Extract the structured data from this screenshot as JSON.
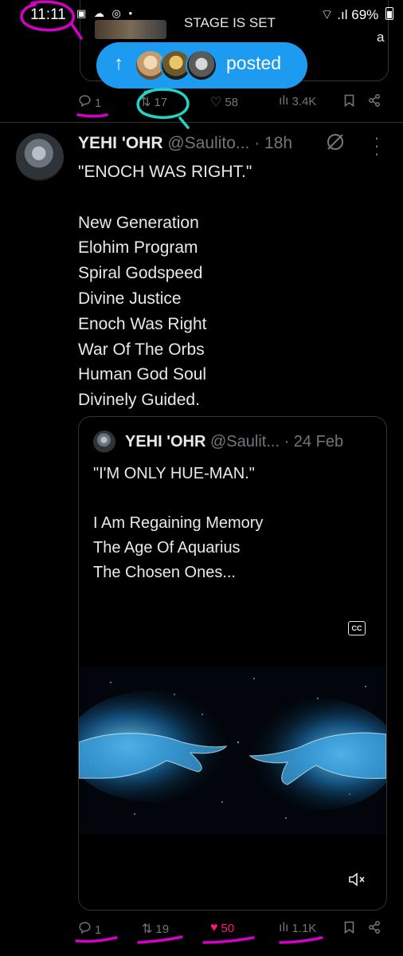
{
  "status_bar": {
    "time": "11:11",
    "left_icons": "▣ ☁ ◎ •",
    "right_icons": "⌔ .ıl",
    "battery": "69%"
  },
  "prev_tweet": {
    "quote_snippet": "STAGE IS SET",
    "quote_snippet_end": "a",
    "actions": {
      "replies": "1",
      "reposts": "17",
      "likes": "58",
      "views": "3.4K"
    }
  },
  "posted_pill": {
    "arrow": "↑",
    "label": "posted"
  },
  "tweet": {
    "name": "YEHI 'OHR",
    "handle": "@Saulito...",
    "time": "· 18h",
    "lines": [
      "\"ENOCH WAS RIGHT.\"",
      "",
      "New Generation",
      "Elohim Program",
      "Spiral Godspeed",
      "Divine Justice",
      "Enoch Was Right",
      "War Of The Orbs",
      "Human God Soul",
      "Divinely Guided."
    ],
    "quote": {
      "name": "YEHI 'OHR",
      "handle": "@Saulit...",
      "date": "· 24 Feb",
      "lines": [
        "\"I'M ONLY HUE-MAN.\"",
        "",
        "I Am Regaining Memory",
        "The Age Of Aquarius",
        "The Chosen Ones..."
      ],
      "cc_label": "CC"
    },
    "actions": {
      "replies": "1",
      "reposts": "19",
      "likes": "50",
      "views": "1.1K"
    }
  },
  "icons": {
    "reply": "reply-icon",
    "repost": "repost-icon",
    "like": "heart-icon",
    "views": "views-icon",
    "bookmark": "bookmark-icon",
    "share": "share-icon",
    "grok": "grok-icon",
    "more": "more-icon",
    "mute": "mute-icon"
  },
  "colors": {
    "accent": "#1d9bf0",
    "like_active": "#f91880",
    "muted_text": "#71767b",
    "annotation_magenta": "#d400c8",
    "annotation_teal": "#23d3c3"
  }
}
